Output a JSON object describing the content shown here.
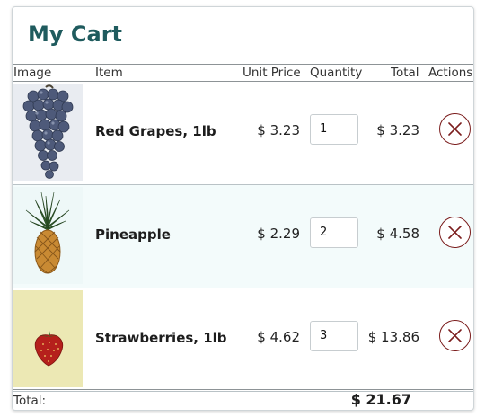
{
  "cart": {
    "title": "My Cart",
    "columns": {
      "image": "Image",
      "item": "Item",
      "unit_price": "Unit Price",
      "quantity": "Quantity",
      "total": "Total",
      "actions": "Actions"
    },
    "items": [
      {
        "name": "Red Grapes, 1lb",
        "unit_price": "$ 3.23",
        "quantity": "1",
        "total": "$ 3.23",
        "image_icon": "grapes-image"
      },
      {
        "name": "Pineapple",
        "unit_price": "$ 2.29",
        "quantity": "2",
        "total": "$ 4.58",
        "image_icon": "pineapple-image"
      },
      {
        "name": "Strawberries, 1lb",
        "unit_price": "$ 4.62",
        "quantity": "3",
        "total": "$ 13.86",
        "image_icon": "strawberry-image"
      }
    ],
    "footer": {
      "label": "Total:",
      "grand_total": "$ 21.67"
    },
    "colors": {
      "title": "#1f5b5e",
      "remove_icon": "#7b1d1d",
      "alt_row": "#f3fbfb"
    }
  }
}
